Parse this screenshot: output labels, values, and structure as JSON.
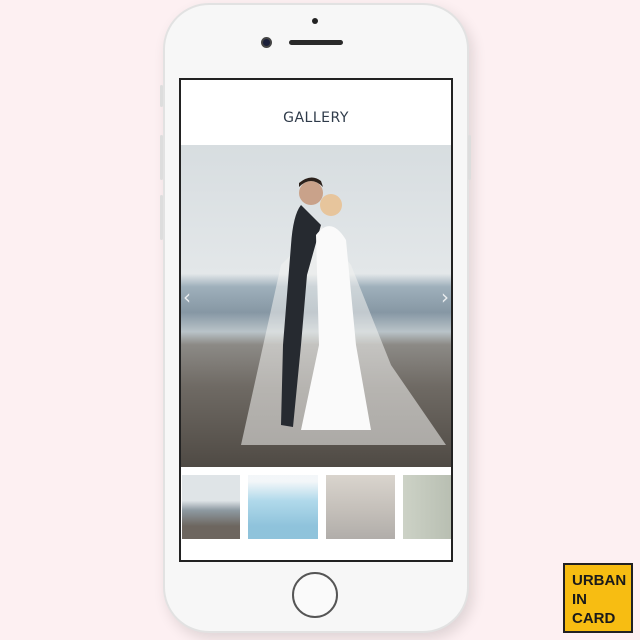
{
  "gallery": {
    "title": "GALLERY"
  },
  "brand": {
    "line1": "URBAN",
    "line2": "IN",
    "line3": "CARD",
    "color": "#f7bd12"
  },
  "icons": {
    "prev": "chevron-left-icon",
    "next": "chevron-right-icon"
  }
}
